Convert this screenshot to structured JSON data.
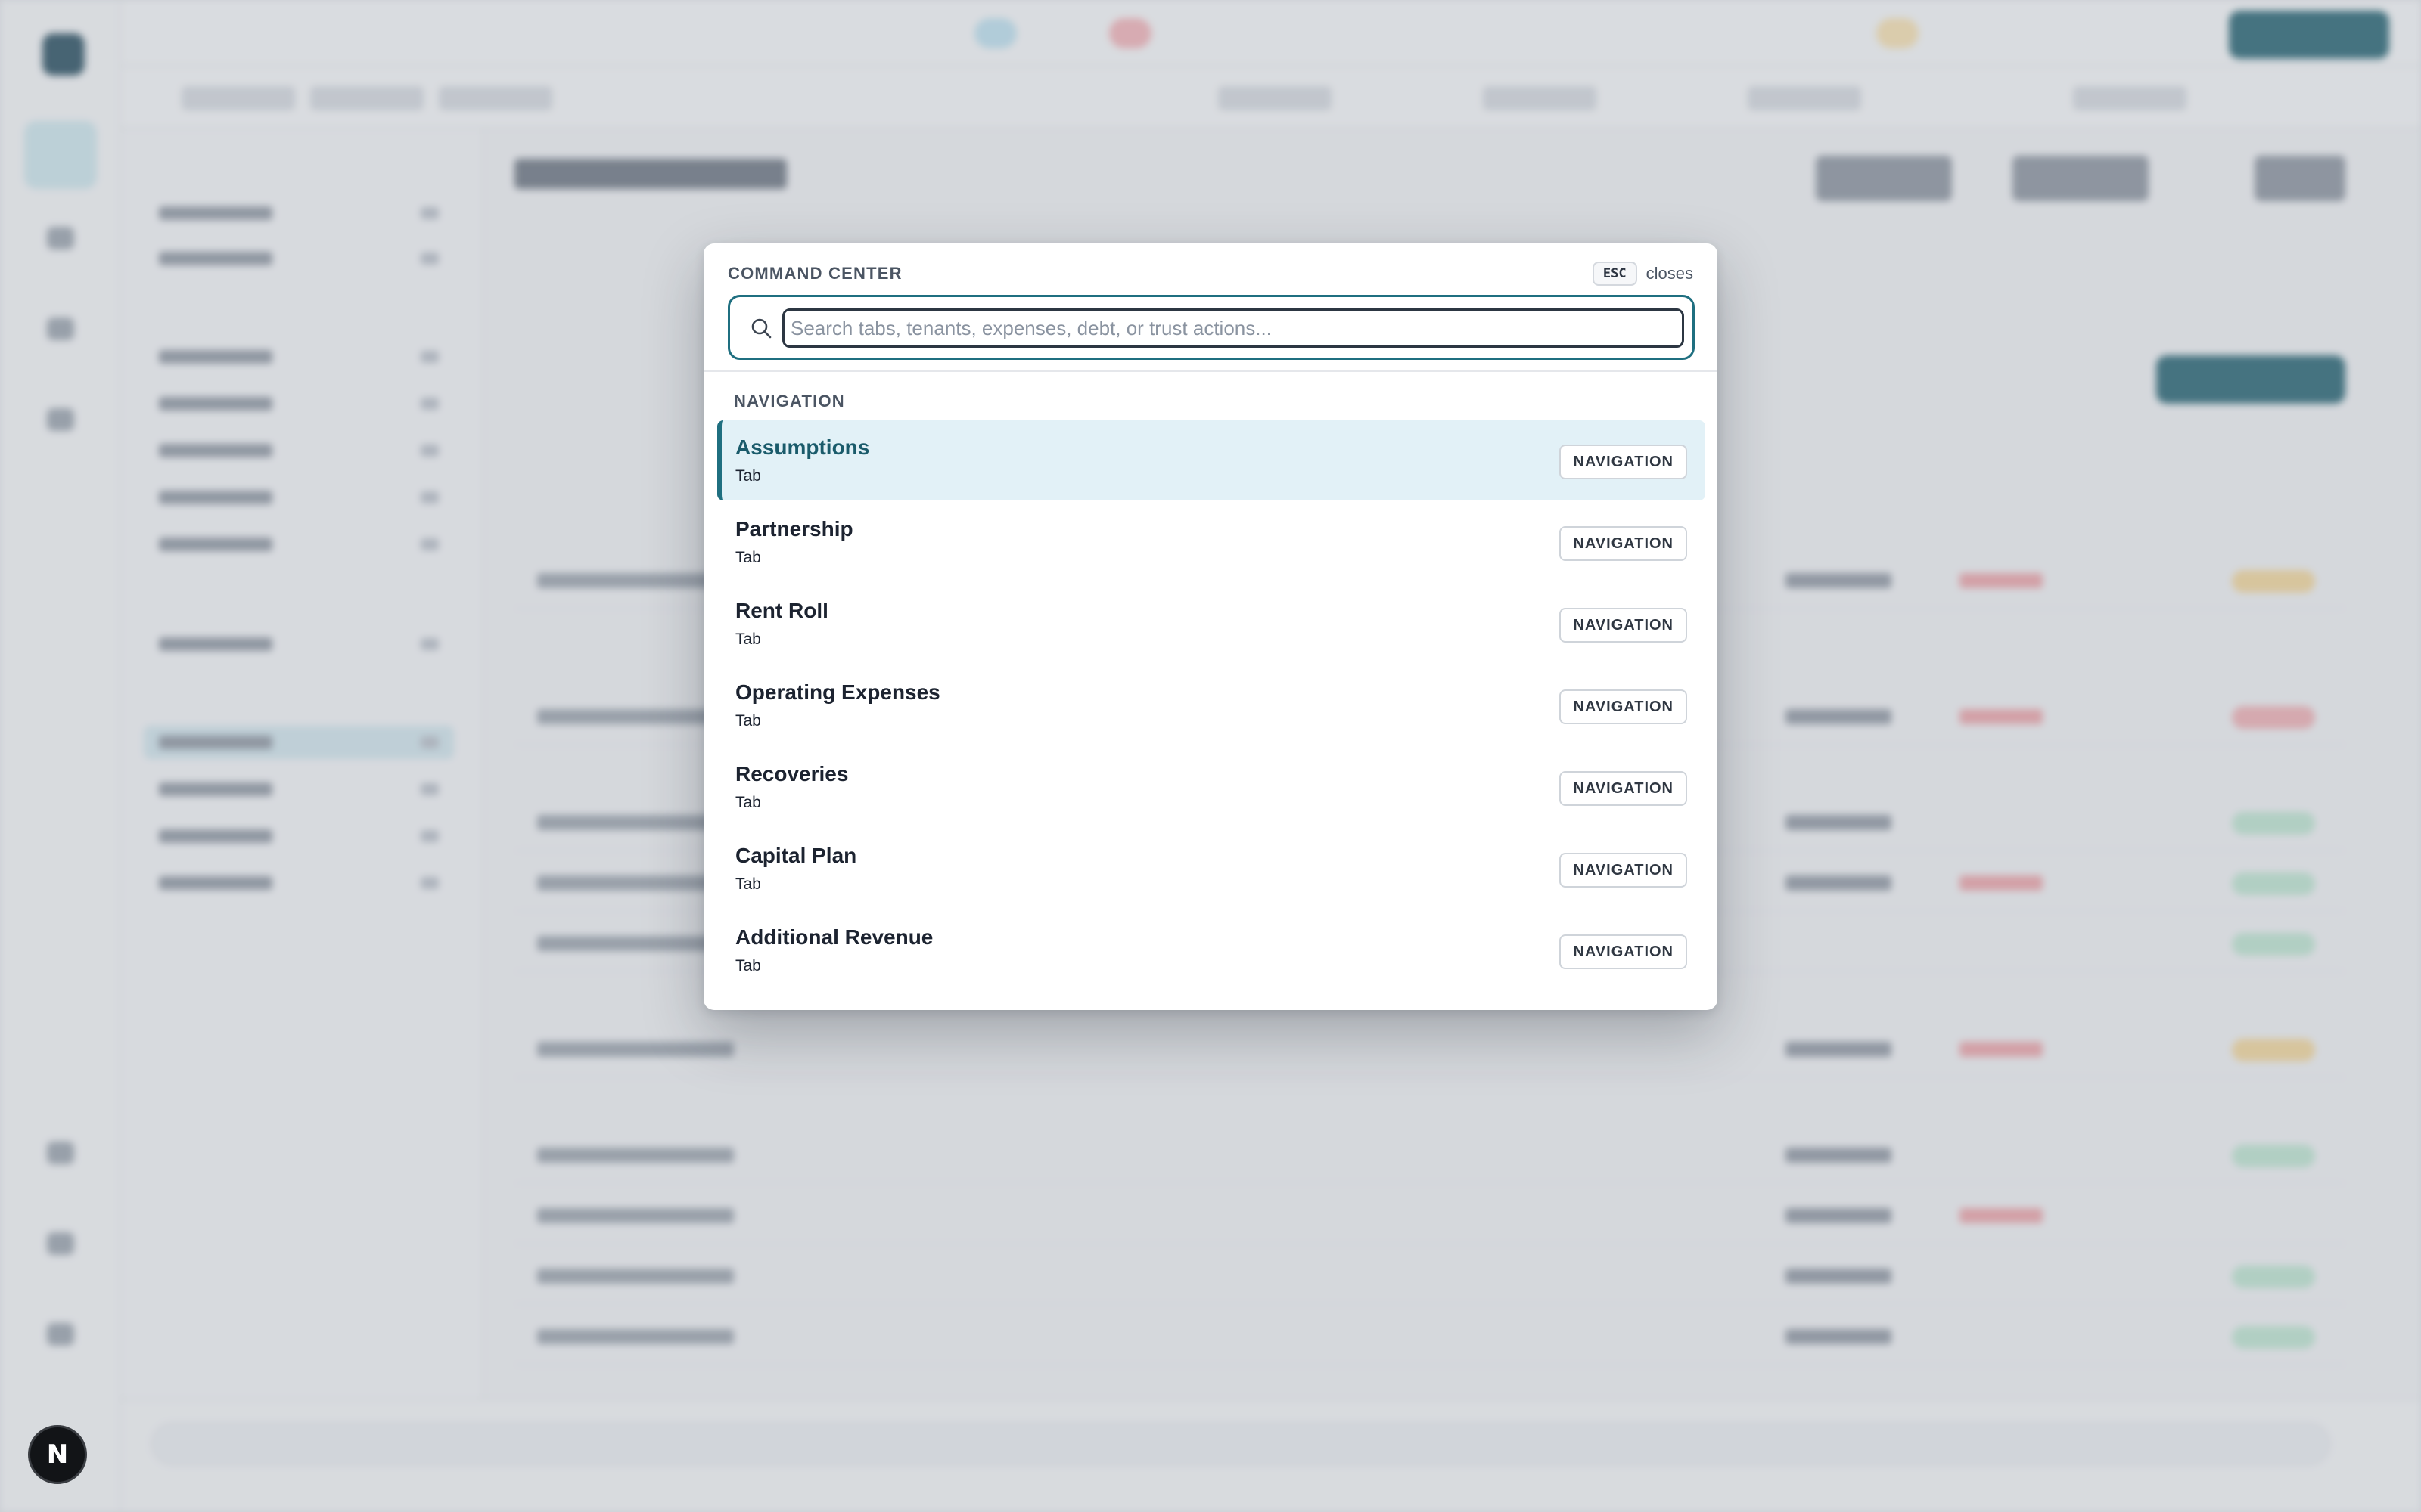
{
  "palette": {
    "title": "COMMAND CENTER",
    "esc_key": "ESC",
    "esc_hint": "closes",
    "search": {
      "placeholder": "Search tabs, tenants, expenses, debt, or trust actions...",
      "value": ""
    },
    "group_label": "NAVIGATION",
    "results": [
      {
        "label": "Assumptions",
        "subtitle": "Tab",
        "tag": "NAVIGATION",
        "selected": true
      },
      {
        "label": "Partnership",
        "subtitle": "Tab",
        "tag": "NAVIGATION",
        "selected": false
      },
      {
        "label": "Rent Roll",
        "subtitle": "Tab",
        "tag": "NAVIGATION",
        "selected": false
      },
      {
        "label": "Operating Expenses",
        "subtitle": "Tab",
        "tag": "NAVIGATION",
        "selected": false
      },
      {
        "label": "Recoveries",
        "subtitle": "Tab",
        "tag": "NAVIGATION",
        "selected": false
      },
      {
        "label": "Capital Plan",
        "subtitle": "Tab",
        "tag": "NAVIGATION",
        "selected": false
      },
      {
        "label": "Additional Revenue",
        "subtitle": "Tab",
        "tag": "NAVIGATION",
        "selected": false
      }
    ]
  },
  "devtools_badge": {
    "letter": "N"
  },
  "colors": {
    "accent": "#1f6f80",
    "selected_bg": "#e2f1f7",
    "overlay": "rgba(150,156,165,0.32)"
  },
  "icons": {
    "search": "search-icon",
    "devtools": "next-devtools-icon"
  }
}
